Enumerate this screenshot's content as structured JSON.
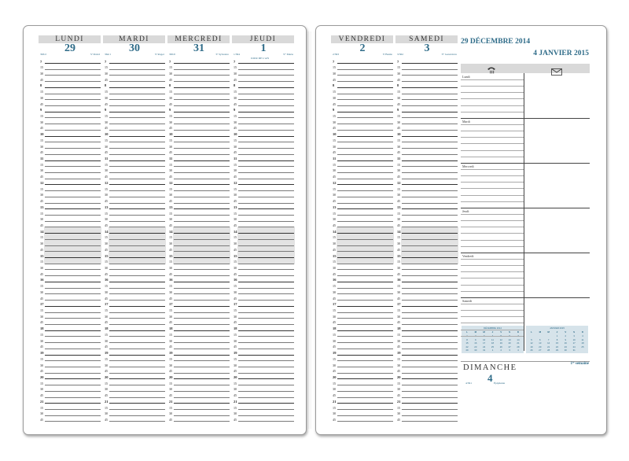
{
  "left_page": {
    "days": [
      {
        "name": "LUNDI",
        "number": "29",
        "day_of_year": "363/2",
        "saint": "Sᵗ David"
      },
      {
        "name": "MARDI",
        "number": "30",
        "day_of_year": "364/1",
        "saint": "Sᵗ Roger"
      },
      {
        "name": "MERCREDI",
        "number": "31",
        "day_of_year": "365/0",
        "saint": "Sᵗ Sylvestre"
      },
      {
        "name": "JEUDI",
        "number": "1",
        "day_of_year": "1/364",
        "saint": "Sᵗᵉ Marie",
        "note": "JOUR DE L'AN"
      }
    ]
  },
  "right_page": {
    "days": [
      {
        "name": "VENDREDI",
        "number": "2",
        "day_of_year": "2/363",
        "saint": "Sᵗ Basile"
      },
      {
        "name": "SAMEDI",
        "number": "3",
        "day_of_year": "3/362",
        "saint": "Sᵗᵉ Geneviève"
      }
    ],
    "range_start": "29 DÉCEMBRE 2014",
    "range_end": "4 JANVIER 2015",
    "phone_icon": "phone-icon",
    "mail_icon": "envelope-icon",
    "weekdays": [
      "Lundi",
      "Mardi",
      "Mercredi",
      "Jeudi",
      "Vendredi",
      "Samedi"
    ],
    "sunday": {
      "name": "DIMANCHE",
      "number": "4",
      "day_of_year": "4/361",
      "note": "Épiphanie"
    },
    "week_label": "1ʳᵉ semaine",
    "mini_calendars": [
      {
        "title": "DÉCEMBRE 2014",
        "headers": [
          "L",
          "M",
          "M",
          "J",
          "V",
          "S",
          "D"
        ],
        "rows": [
          [
            "1",
            "2",
            "3",
            "4",
            "5",
            "6",
            "7"
          ],
          [
            "8",
            "9",
            "10",
            "11",
            "12",
            "13",
            "14"
          ],
          [
            "15",
            "16",
            "17",
            "18",
            "19",
            "20",
            "21"
          ],
          [
            "22",
            "23",
            "24",
            "25",
            "26",
            "27",
            "28"
          ],
          [
            "29",
            "30",
            "31",
            "1",
            "2",
            "3",
            "4"
          ]
        ]
      },
      {
        "title": "JANVIER 2015",
        "headers": [
          "L",
          "M",
          "M",
          "J",
          "V",
          "S",
          "D"
        ],
        "rows": [
          [
            "",
            "",
            "",
            "1",
            "2",
            "3",
            "4"
          ],
          [
            "5",
            "6",
            "7",
            "8",
            "9",
            "10",
            "11"
          ],
          [
            "12",
            "13",
            "14",
            "15",
            "16",
            "17",
            "18"
          ],
          [
            "19",
            "20",
            "21",
            "22",
            "23",
            "24",
            "25"
          ],
          [
            "26",
            "27",
            "28",
            "29",
            "30",
            "31",
            ""
          ]
        ]
      }
    ]
  },
  "hours": [
    "7",
    "8",
    "9",
    "10",
    "11",
    "12",
    "13",
    "14",
    "15",
    "16",
    "17",
    "18",
    "19",
    "20",
    "21"
  ],
  "quarter_marks": [
    "15",
    "30",
    "45"
  ],
  "colors": {
    "accent": "#2e6b88",
    "header_bg": "#d9d9d9",
    "shade": "#e3e3e3",
    "mini_bg": "#d6e3ea"
  }
}
